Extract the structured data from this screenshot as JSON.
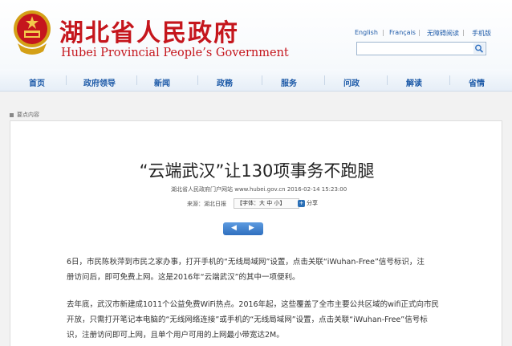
{
  "header": {
    "title_cn": "湖北省人民政府",
    "title_en": "Hubei Provincial People’s Government",
    "links": [
      "English",
      "Français",
      "无障碍阅读",
      "手机版"
    ],
    "search_placeholder": ""
  },
  "nav": {
    "items": [
      "首页",
      "政府领导",
      "新闻",
      "政務",
      "服务",
      "问政",
      "解读",
      "省情"
    ]
  },
  "breadcrumb": "要点内容",
  "article": {
    "headline": "“云端武汉”让130项事务不跑腿",
    "meta_source": "湖北省人民政府门户网站 www.hubei.gov.cn 2016-02-14 15:23:00",
    "meta_from": "来源：湖北日报",
    "font_size_label": "【字体：大 中 小】",
    "share_label": "分享",
    "pager_prev": "◀",
    "pager_next": "▶",
    "p1": [
      "6日，市民陈秋萍到市民之家办事，打开手机的“无线局域网”设置，点击关联“iWuhan-Free”信号标识，注",
      "册访问后，即可免费上网。这是2016年“云端武汉”的其中一项便利。"
    ],
    "p2": [
      "去年底，武汉市新建成1011个公益免费WiFi热点。2016年起，这些覆盖了全市主要公共区域的wifi正式向市民",
      "开放，只需打开笔记本电脑的“无线网络连接”或手机的“无线局域网”设置，点击关联“iWuhan-Free”信号标",
      "识，注册访问即可上网，且单个用户可用的上网最小带宽达2M。"
    ]
  },
  "colors": {
    "brand_red": "#c5161d",
    "link_blue": "#1d5aa8"
  }
}
